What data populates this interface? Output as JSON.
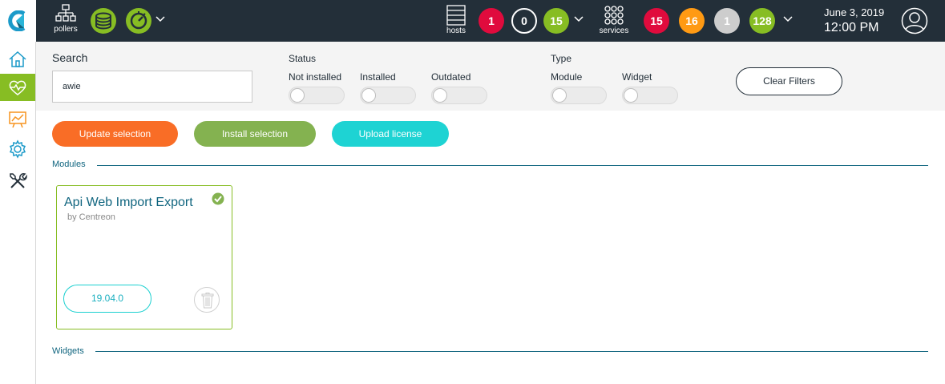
{
  "header": {
    "pollers_label": "pollers",
    "hosts_label": "hosts",
    "services_label": "services",
    "host_counts": [
      {
        "value": "1",
        "color": "#e00b3d",
        "status": "down"
      },
      {
        "value": "0",
        "color": "#232f39",
        "status": "unreachable"
      },
      {
        "value": "15",
        "color": "#87bd23",
        "status": "up"
      }
    ],
    "service_counts": [
      {
        "value": "15",
        "color": "#e00b3d",
        "status": "critical"
      },
      {
        "value": "16",
        "color": "#ff9a13",
        "status": "warning"
      },
      {
        "value": "1",
        "color": "#cdcdcd",
        "status": "unknown"
      },
      {
        "value": "128",
        "color": "#87bd23",
        "status": "ok"
      }
    ],
    "date": "June 3, 2019",
    "time": "12:00 PM",
    "icons": [
      "logo-icon",
      "pollers-icon",
      "database-icon",
      "gauge-icon",
      "hosts-icon",
      "services-icon",
      "user-icon"
    ]
  },
  "sidebar": {
    "items": [
      {
        "icon": "home-icon",
        "active": false
      },
      {
        "icon": "monitoring-icon",
        "active": true
      },
      {
        "icon": "reporting-icon",
        "active": false
      },
      {
        "icon": "configuration-icon",
        "active": false
      },
      {
        "icon": "administration-icon",
        "active": false
      }
    ]
  },
  "filters": {
    "search_label": "Search",
    "search_value": "awie",
    "status_title": "Status",
    "status_options": [
      "Not installed",
      "Installed",
      "Outdated"
    ],
    "type_title": "Type",
    "type_options": [
      "Module",
      "Widget"
    ],
    "clear_label": "Clear Filters"
  },
  "actions": {
    "update_label": "Update selection",
    "install_label": "Install selection",
    "upload_label": "Upload license"
  },
  "sections": {
    "modules_label": "Modules",
    "widgets_label": "Widgets"
  },
  "modules": [
    {
      "title": "Api Web Import Export",
      "author": "by Centreon",
      "version": "19.04.0",
      "installed": true
    }
  ],
  "colors": {
    "header_bg": "#232f39",
    "accent_green": "#87bd23",
    "update_orange": "#f96d26",
    "upload_cyan": "#1ed3d3",
    "section_blue": "#10657f"
  }
}
